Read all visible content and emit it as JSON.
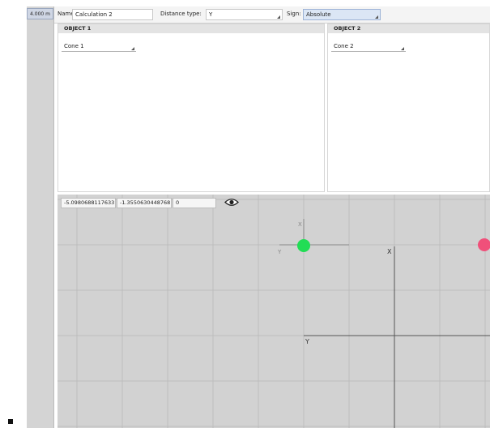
{
  "distance_badge": "4.000 m",
  "header": {
    "name_label": "Name:",
    "name_value": "Calculation 2",
    "distance_type_label": "Distance type:",
    "distance_type_value": "Y",
    "sign_label": "Sign:",
    "sign_value": "Absolute"
  },
  "object1": {
    "title": "OBJECT 1",
    "selected": "Cone 1"
  },
  "object2": {
    "title": "OBJECT 2",
    "selected": "Cone 2"
  },
  "viewport": {
    "coord_x": "-5.0980688117633",
    "coord_y": "-1.3550630448768",
    "coord_z": "0",
    "eye_icon": "eye-icon",
    "axis_labels": {
      "small_y": "Y",
      "small_x": "X",
      "big_x": "X",
      "big_y": "Y"
    },
    "colors": {
      "green_marker": "#22dd55",
      "red_marker": "#f0507a",
      "grid": "#b8b8b8"
    }
  }
}
